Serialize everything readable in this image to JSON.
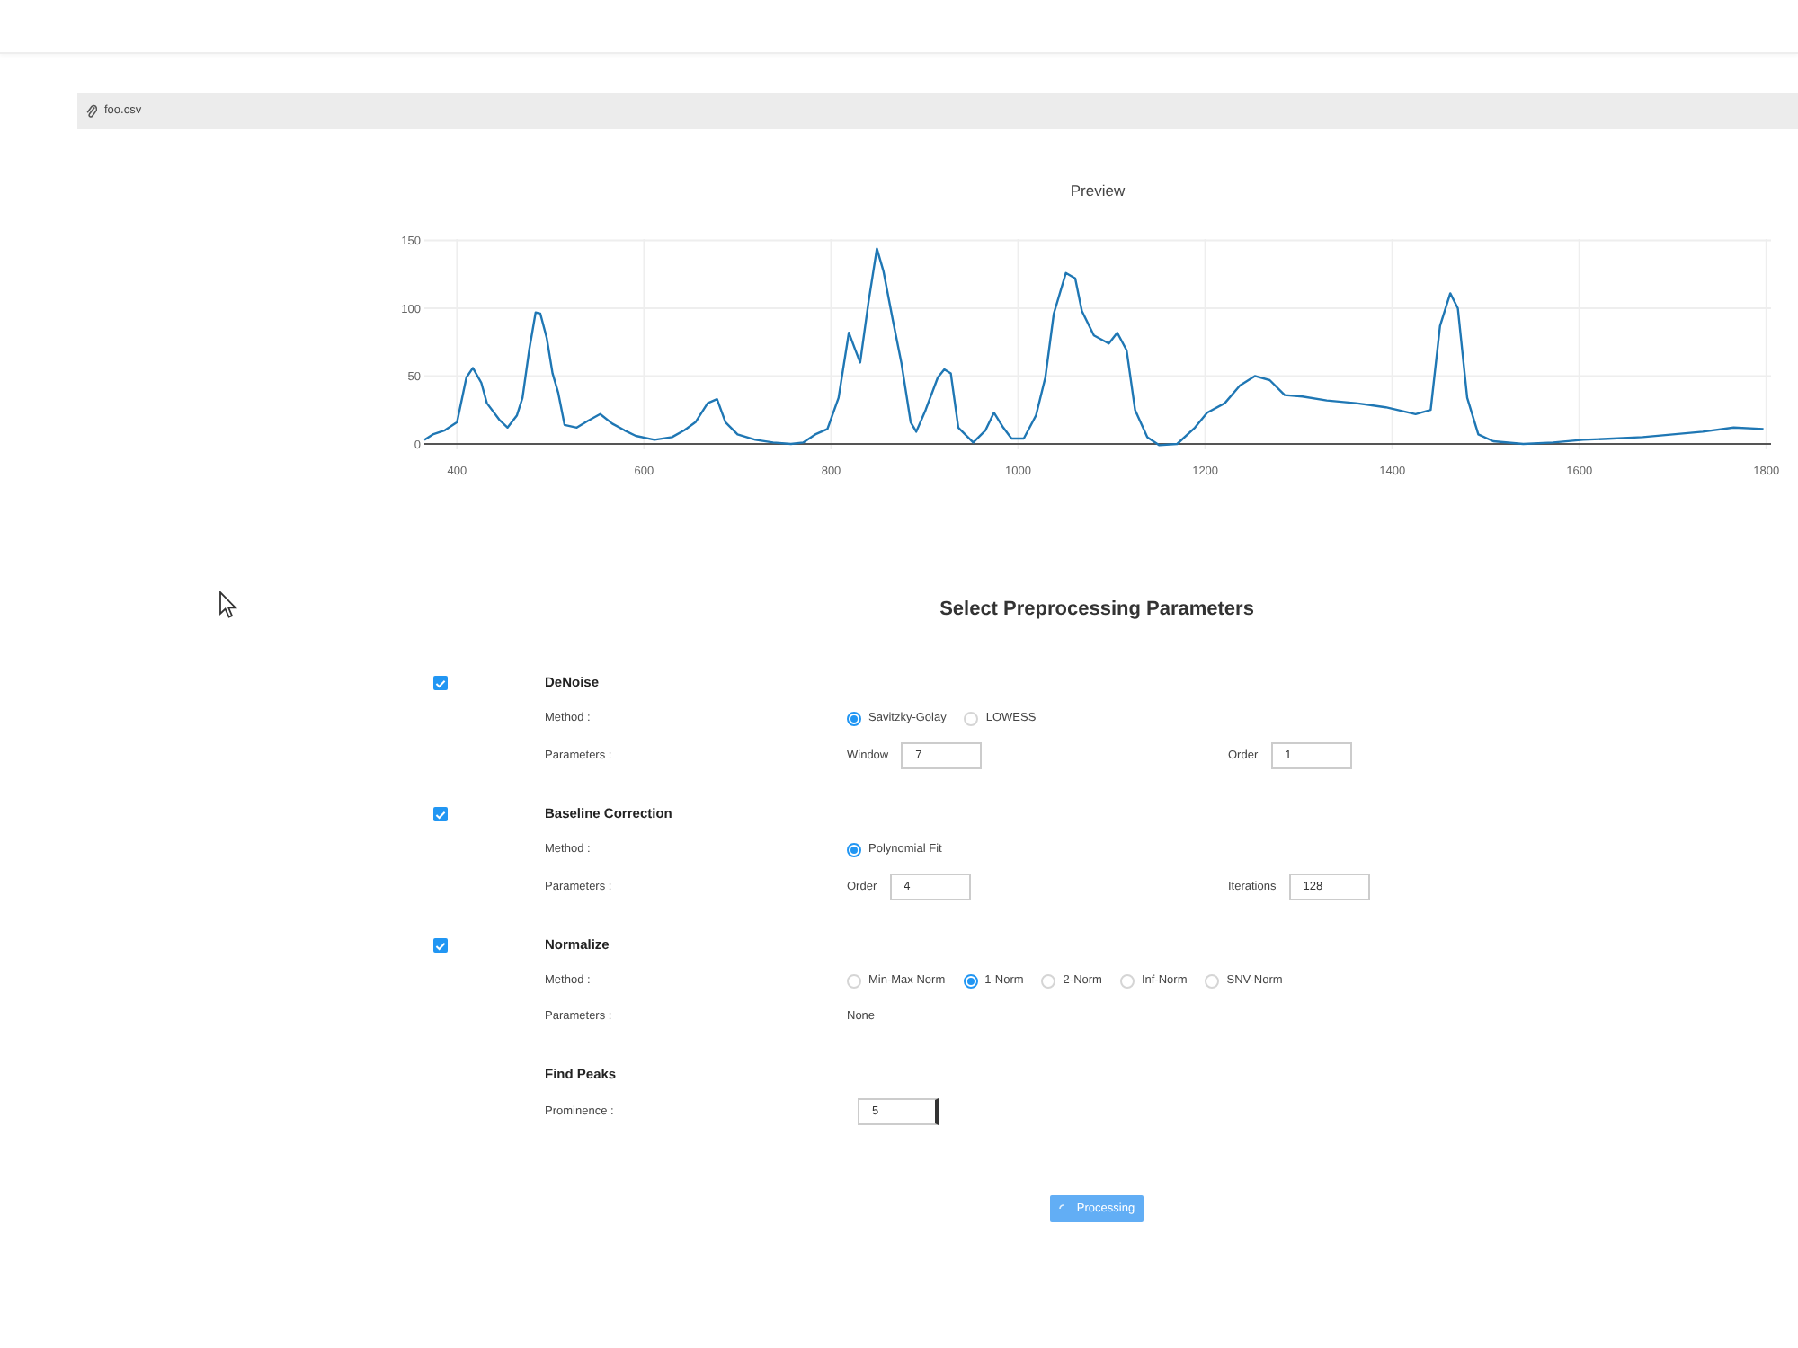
{
  "file_bar": {
    "file_name": "foo.csv"
  },
  "preview": {
    "chart_data": [
      {
        "type": "line",
        "title": "Preview",
        "xlim": [
          365,
          1805
        ],
        "ylim": [
          -4,
          151
        ],
        "xticks": [
          400,
          600,
          800,
          1000,
          1200,
          1400,
          1600,
          1800
        ],
        "yticks": [
          0,
          50,
          100,
          150
        ],
        "grid": true,
        "color": "#1f77b4",
        "x": [
          365,
          374,
          387,
          400,
          410,
          417,
          426,
          432,
          445,
          454,
          464,
          470,
          477,
          484,
          489,
          496,
          502,
          508,
          515,
          528,
          540,
          553,
          566,
          579,
          591,
          611,
          630,
          643,
          655,
          668,
          678,
          687,
          700,
          719,
          738,
          757,
          770,
          783,
          796,
          808,
          819,
          826,
          831,
          840,
          849,
          856,
          866,
          875,
          885,
          891,
          901,
          914,
          921,
          928,
          936,
          952,
          965,
          974,
          984,
          993,
          1006,
          1019,
          1029,
          1038,
          1051,
          1061,
          1068,
          1081,
          1097,
          1106,
          1116,
          1125,
          1138,
          1151,
          1170,
          1189,
          1202,
          1221,
          1237,
          1253,
          1269,
          1285,
          1304,
          1330,
          1361,
          1393,
          1425,
          1441,
          1451,
          1462,
          1470,
          1480,
          1492,
          1508,
          1540,
          1572,
          1604,
          1636,
          1668,
          1700,
          1732,
          1765,
          1797
        ],
        "values": [
          3,
          7,
          10,
          16,
          49,
          56,
          45,
          30,
          18,
          12,
          21,
          34,
          69,
          97,
          96,
          78,
          52,
          38,
          14,
          12,
          17,
          22,
          15,
          10,
          6,
          3,
          5,
          10,
          16,
          30,
          33,
          16,
          7,
          3,
          1,
          0,
          1,
          7,
          11,
          34,
          82,
          69,
          60,
          105,
          144,
          127,
          91,
          60,
          16,
          9,
          25,
          49,
          55,
          52,
          12,
          1,
          10,
          23,
          12,
          4,
          4,
          21,
          49,
          96,
          126,
          122,
          98,
          80,
          74,
          82,
          69,
          25,
          5,
          -1,
          0,
          12,
          23,
          30,
          43,
          50,
          47,
          36,
          35,
          32,
          30,
          27,
          22,
          25,
          87,
          111,
          100,
          34,
          7,
          2,
          0,
          1,
          3,
          4,
          5,
          7,
          9,
          12,
          11
        ]
      }
    ]
  },
  "form": {
    "title": "Select Preprocessing Parameters",
    "sections": [
      {
        "title": "DeNoise",
        "checked": true,
        "rows": [
          {
            "kind": "radios",
            "label": "Method :",
            "options": [
              {
                "label": "Savitzky-Golay",
                "selected": true
              },
              {
                "label": "LOWESS",
                "selected": false
              }
            ]
          },
          {
            "kind": "fields",
            "label": "Parameters :",
            "fields": [
              {
                "label": "Window",
                "value": "7"
              },
              {
                "label": "Order",
                "value": "1"
              }
            ]
          }
        ]
      },
      {
        "title": "Baseline Correction",
        "checked": true,
        "rows": [
          {
            "kind": "radios",
            "label": "Method :",
            "options": [
              {
                "label": "Polynomial Fit",
                "selected": true
              }
            ]
          },
          {
            "kind": "fields",
            "label": "Parameters :",
            "fields": [
              {
                "label": "Order",
                "value": "4"
              },
              {
                "label": "Iterations",
                "value": "128"
              }
            ]
          }
        ]
      },
      {
        "title": "Normalize",
        "checked": true,
        "rows": [
          {
            "kind": "radios",
            "label": "Method :",
            "options": [
              {
                "label": "Min-Max Norm",
                "selected": false
              },
              {
                "label": "1-Norm",
                "selected": true
              },
              {
                "label": "2-Norm",
                "selected": false
              },
              {
                "label": "Inf-Norm",
                "selected": false
              },
              {
                "label": "SNV-Norm",
                "selected": false
              }
            ]
          },
          {
            "kind": "text",
            "label": "Parameters :",
            "value": "None"
          }
        ]
      }
    ],
    "find_peaks": {
      "title": "Find Peaks",
      "label": "Prominence :",
      "value": "5",
      "focused": true
    }
  },
  "process_button": {
    "label": "Processing"
  }
}
